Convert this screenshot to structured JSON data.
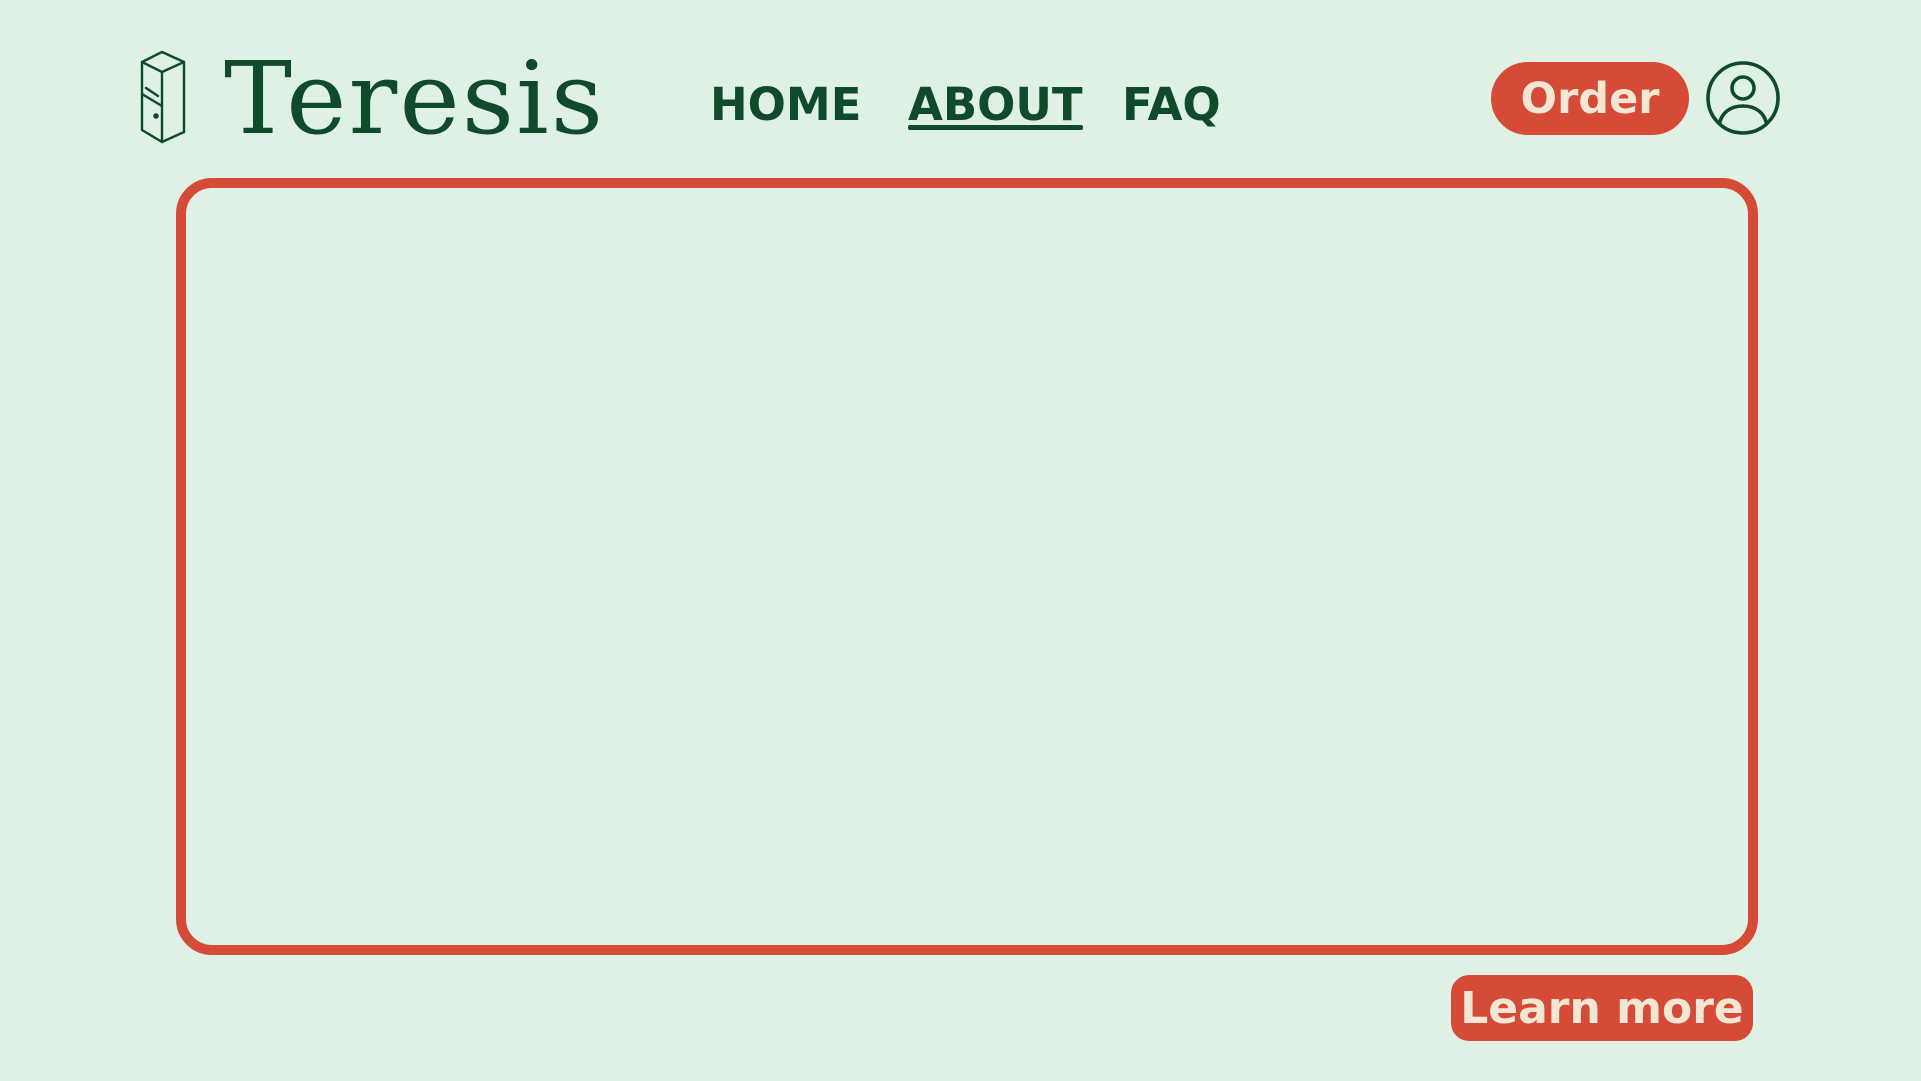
{
  "brand": {
    "name": "Teresis",
    "logo_icon": "open-door-icon"
  },
  "nav": {
    "items": [
      {
        "label": "HOME",
        "active": false
      },
      {
        "label": "ABOUT",
        "active": true
      },
      {
        "label": "FAQ",
        "active": false
      }
    ]
  },
  "header": {
    "order_label": "Order",
    "profile_icon": "user-profile-icon"
  },
  "main": {
    "cta_label": "Learn more"
  },
  "colors": {
    "background": "#dff0e4",
    "primary_text": "#0f4a2a",
    "accent": "#d64b37",
    "button_text": "#f3e6d3"
  }
}
